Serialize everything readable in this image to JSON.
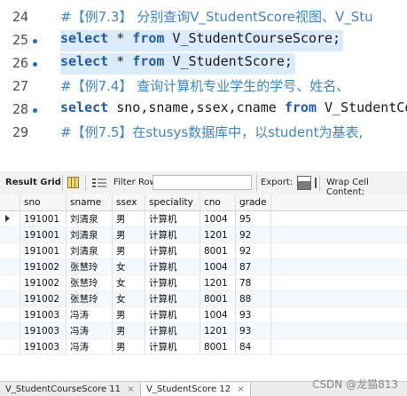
{
  "editor": {
    "lines": [
      {
        "num": "24",
        "text": "#【例7.3】 分别查询V_StudentScore视图、V_Stu"
      },
      {
        "num": "25",
        "kw": "select",
        "mid": " * ",
        "kw2": "from",
        "rest": " V_StudentCourseScore;"
      },
      {
        "num": "26",
        "kw": "select",
        "mid": " * ",
        "kw2": "from",
        "rest": " V_StudentScore;"
      },
      {
        "num": "27",
        "text": "#【例7.4】 查询计算机专业学生的学号、姓名、"
      },
      {
        "num": "28",
        "kw": "select",
        "mid": " sno,sname,ssex,cname ",
        "kw2": "from",
        "rest": " V_StudentCo"
      },
      {
        "num": "29",
        "text": "#【例7.5】在stusys数据库中，以student为基表,"
      }
    ]
  },
  "toolbar": {
    "result_tab": "Result Grid",
    "filter_label": "Filter Rows:",
    "filter_value": "",
    "export_label": "Export:",
    "wrap_label": "Wrap Cell Content:"
  },
  "grid": {
    "columns": [
      "sno",
      "sname",
      "ssex",
      "speciality",
      "cno",
      "grade"
    ],
    "rows": [
      [
        "191001",
        "刘清泉",
        "男",
        "计算机",
        "1004",
        "95"
      ],
      [
        "191001",
        "刘清泉",
        "男",
        "计算机",
        "1201",
        "92"
      ],
      [
        "191001",
        "刘清泉",
        "男",
        "计算机",
        "8001",
        "92"
      ],
      [
        "191002",
        "张慧玲",
        "女",
        "计算机",
        "1004",
        "87"
      ],
      [
        "191002",
        "张慧玲",
        "女",
        "计算机",
        "1201",
        "78"
      ],
      [
        "191002",
        "张慧玲",
        "女",
        "计算机",
        "8001",
        "88"
      ],
      [
        "191003",
        "冯涛",
        "男",
        "计算机",
        "1004",
        "93"
      ],
      [
        "191003",
        "冯涛",
        "男",
        "计算机",
        "1201",
        "93"
      ],
      [
        "191003",
        "冯涛",
        "男",
        "计算机",
        "8001",
        "84"
      ]
    ]
  },
  "tabs": [
    {
      "label": "V_StudentCourseScore 11",
      "active": false
    },
    {
      "label": "V_StudentScore 12",
      "active": true
    }
  ],
  "watermark": "CSDN @龙猫813",
  "colors": {
    "keyword": "#1f5da8",
    "comment": "#3d86c6",
    "line_highlight": "#dcebfa"
  }
}
